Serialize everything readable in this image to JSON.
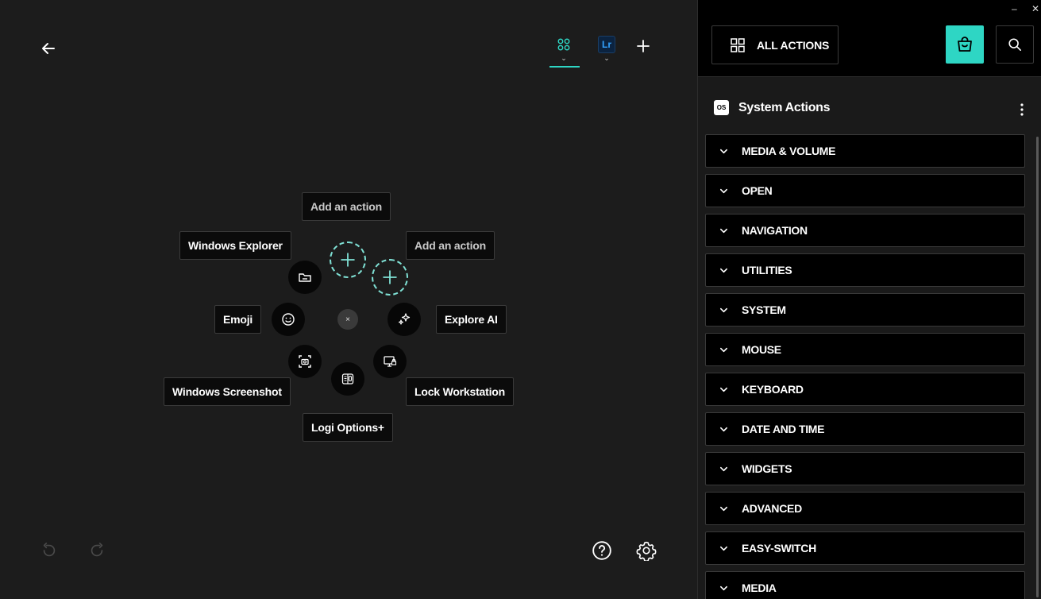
{
  "canvas": {
    "tabs": [
      {
        "name": "all-apps",
        "active": true
      },
      {
        "name": "lightroom",
        "label": "Lr",
        "active": false
      }
    ],
    "wheel": {
      "items": {
        "top_add": "Add an action",
        "right_add": "Add an action",
        "windows_explorer": "Windows Explorer",
        "emoji": "Emoji",
        "explore_ai": "Explore AI",
        "windows_screenshot": "Windows Screenshot",
        "lock_workstation": "Lock Workstation",
        "logi_options": "Logi Options+"
      },
      "center_close": "×"
    }
  },
  "panel": {
    "window_controls": {
      "minimize": "–",
      "close": "✕"
    },
    "all_actions_label": "ALL ACTIONS",
    "section_title": "System Actions",
    "os_badge": "OS",
    "categories": [
      "MEDIA & VOLUME",
      "OPEN",
      "NAVIGATION",
      "UTILITIES",
      "SYSTEM",
      "MOUSE",
      "KEYBOARD",
      "DATE AND TIME",
      "WIDGETS",
      "ADVANCED",
      "EASY-SWITCH",
      "MEDIA"
    ]
  },
  "colors": {
    "accent": "#2ed6c4",
    "background": "#1c1c1c",
    "panel": "#000000"
  }
}
